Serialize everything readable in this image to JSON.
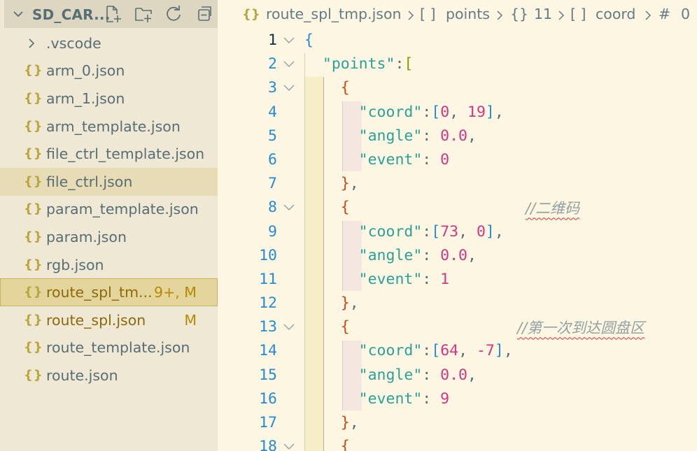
{
  "explorer": {
    "title": "SD_CAR...",
    "actions": [
      "new-file-icon",
      "new-folder-icon",
      "refresh-icon",
      "collapse-all-icon"
    ],
    "items": [
      {
        "type": "folder",
        "name": ".vscode",
        "badge": ""
      },
      {
        "type": "json",
        "name": "arm_0.json",
        "badge": ""
      },
      {
        "type": "json",
        "name": "arm_1.json",
        "badge": ""
      },
      {
        "type": "json",
        "name": "arm_template.json",
        "badge": ""
      },
      {
        "type": "json",
        "name": "file_ctrl_template.json",
        "badge": ""
      },
      {
        "type": "json",
        "name": "file_ctrl.json",
        "badge": "",
        "state": "hover"
      },
      {
        "type": "json",
        "name": "param_template.json",
        "badge": ""
      },
      {
        "type": "json",
        "name": "param.json",
        "badge": ""
      },
      {
        "type": "json",
        "name": "rgb.json",
        "badge": ""
      },
      {
        "type": "json",
        "name": "route_spl_tm...",
        "badge": "9+, M",
        "state": "selected"
      },
      {
        "type": "json",
        "name": "route_spl.json",
        "badge": "M",
        "state": "modified"
      },
      {
        "type": "json",
        "name": "route_template.json",
        "badge": ""
      },
      {
        "type": "json",
        "name": "route.json",
        "badge": ""
      }
    ],
    "json_icon": "{}"
  },
  "breadcrumb": {
    "file_icon": "{}",
    "file": "route_spl_tmp.json",
    "items": [
      {
        "icon": "[ ]",
        "label": "points"
      },
      {
        "icon": "{}",
        "label": "11"
      },
      {
        "icon": "[ ]",
        "label": "coord"
      },
      {
        "icon": "#",
        "label": "0"
      }
    ]
  },
  "editor": {
    "line_numbers": [
      "1",
      "2",
      "3",
      "4",
      "5",
      "6",
      "7",
      "8",
      "9",
      "10",
      "11",
      "12",
      "13",
      "14",
      "15",
      "16",
      "17",
      "18"
    ],
    "comments": [
      "//二维码",
      "//第一次到达圆盘区"
    ],
    "key_points": "\"points\"",
    "key_coord": "\"coord\"",
    "key_angle": "\"angle\"",
    "key_event": "\"event\"",
    "points": [
      {
        "x": "0",
        "y": "19",
        "angle": "0.0",
        "event": "0"
      },
      {
        "x": "73",
        "y": "0",
        "angle": "0.0",
        "event": "1"
      },
      {
        "x": "64",
        "y": "-7",
        "angle": "0.0",
        "event": "9"
      }
    ]
  },
  "colors": {
    "sidebar_bg": "#eee8d5",
    "editor_bg": "#fdf6e3",
    "selected_bg": "#e3d59c",
    "json_icon": "#b8a73c",
    "key": "#2aa198",
    "number": "#d33682",
    "line_number": "#268bd2"
  }
}
